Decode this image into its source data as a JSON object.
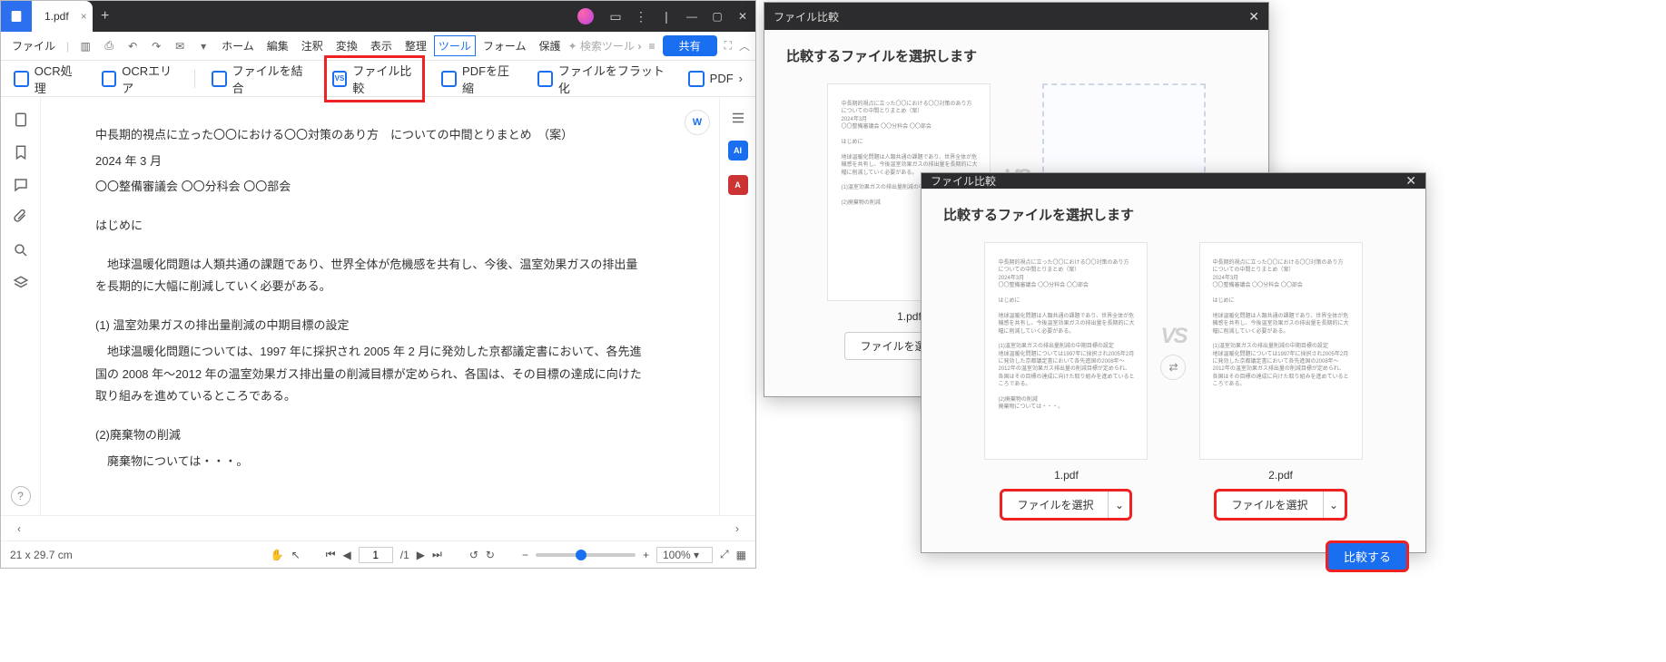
{
  "titlebar": {
    "tab_name": "1.pdf"
  },
  "menubar": {
    "file": "ファイル",
    "items": [
      "ホーム",
      "編集",
      "注釈",
      "変換",
      "表示",
      "整理",
      "ツール",
      "フォーム",
      "保護"
    ],
    "search_placeholder": "検索ツール",
    "share": "共有"
  },
  "toolbar": {
    "ocr": "OCR処理",
    "ocr_area": "OCRエリア",
    "merge": "ファイルを結合",
    "compare": "ファイル比較",
    "compress": "PDFを圧縮",
    "flatten": "ファイルをフラット化",
    "pdf_more": "PDF"
  },
  "doc": {
    "p1": "中長期的視点に立った〇〇における〇〇対策のあり方　についての中間とりまとめ　（案）",
    "p2": "2024 年 3 月",
    "p3": "〇〇整備審議会 〇〇分科会 〇〇部会",
    "p4": "はじめに",
    "p5": "　地球温暖化問題は人類共通の課題であり、世界全体が危機感を共有し、今後、温室効果ガスの排出量を長期的に大幅に削減していく必要がある。",
    "p6": "(1) 温室効果ガスの排出量削減の中期目標の設定",
    "p7": "　地球温暖化問題については、1997 年に採択され 2005 年 2 月に発効した京都議定書において、各先進国の 2008 年～2012 年の温室効果ガス排出量の削減目標が定められ、各国は、その目標の達成に向けた取り組みを進めているところである。",
    "p8": "(2)廃棄物の削減",
    "p9": "　廃棄物については・・・。",
    "float_w": "W"
  },
  "status": {
    "dim": "21 x 29.7 cm",
    "page": "1",
    "pages": "/1",
    "zoom": "100%"
  },
  "dialog": {
    "title": "ファイル比較",
    "subtitle": "比較するファイルを選択します",
    "file1": "1.pdf",
    "file2": "2.pdf",
    "select": "ファイルを選択",
    "vs": "VS",
    "compare": "比較する"
  },
  "rightbar": {
    "ai": "AI",
    "az": "A"
  }
}
